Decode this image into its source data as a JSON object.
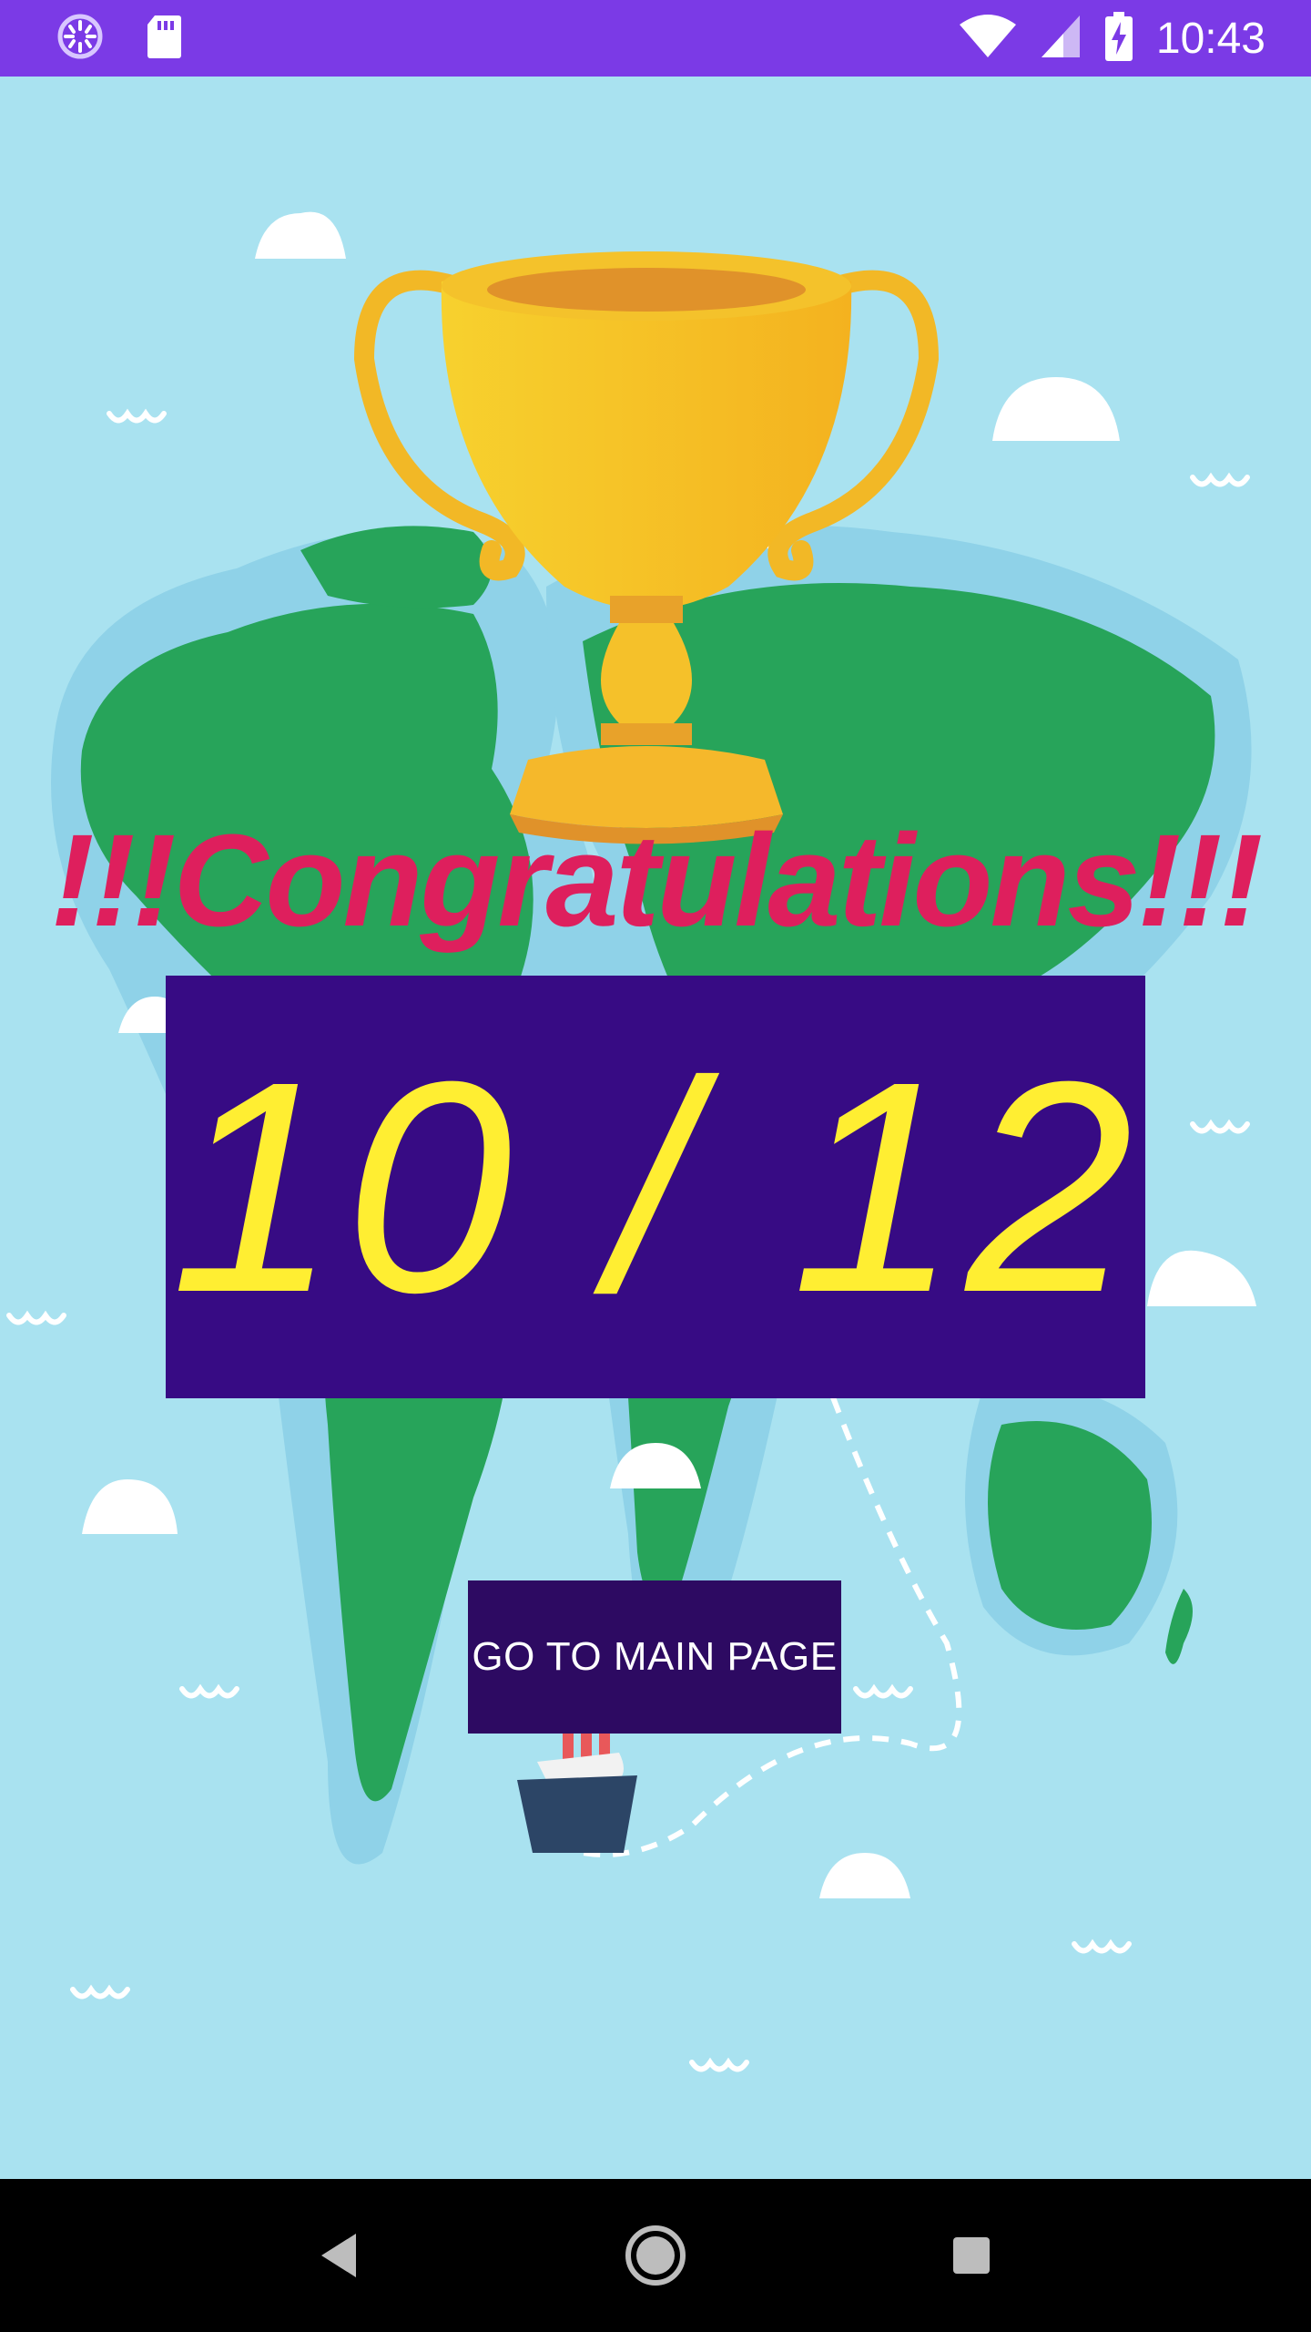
{
  "status_bar": {
    "time": "10:43",
    "icons": [
      "loading-icon",
      "sd-card-icon",
      "wifi-icon",
      "signal-icon",
      "battery-charging-icon"
    ],
    "color": "#7b3ae6"
  },
  "result": {
    "title": "!!!Congratulations!!!",
    "score": "10 / 12",
    "title_color": "#de1f5d",
    "score_color": "#ffee32",
    "score_bg": "#370b84"
  },
  "actions": {
    "main_page_label": "GO TO MAIN PAGE",
    "button_bg": "#2d0a62"
  },
  "illustration": {
    "icons": [
      "trophy-icon",
      "world-map-illustration",
      "ship-icon",
      "cloud-icon",
      "wave-icon"
    ],
    "sea_color": "#a9e2f0",
    "land_color": "#27a45a",
    "trophy_color": "#f5b82b"
  },
  "nav_bar": {
    "icons": [
      "back-icon",
      "home-icon",
      "recents-icon"
    ]
  }
}
